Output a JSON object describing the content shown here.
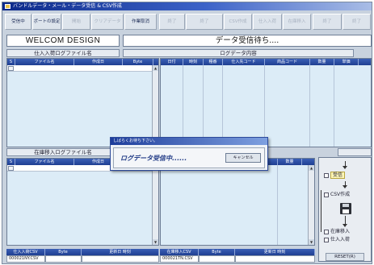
{
  "window": {
    "title": "バンドルデータ・メール・データ受信 & CSV作成"
  },
  "toolbar": {
    "buttons": [
      {
        "label": "受信中",
        "enabled": true
      },
      {
        "label": "ポートの設定",
        "enabled": true
      },
      {
        "label": "開始",
        "enabled": false
      },
      {
        "label": "クリアデータ",
        "enabled": false
      },
      {
        "label": "作業取消",
        "enabled": true
      },
      {
        "label": "終了",
        "enabled": false
      },
      {
        "label": "終了",
        "enabled": false
      },
      {
        "label": "CSV作成",
        "enabled": false
      },
      {
        "label": "仕入入荷",
        "enabled": false
      },
      {
        "label": "在庫移入",
        "enabled": false
      },
      {
        "label": "終了",
        "enabled": false
      },
      {
        "label": "終了",
        "enabled": false
      }
    ]
  },
  "banner": {
    "company": "WELCOM DESIGN",
    "status": "データ受信待ち...."
  },
  "left_top": {
    "header": "仕入入荷ログファイル名",
    "columns": [
      "S",
      "ファイル名",
      "作成日",
      "Byte"
    ]
  },
  "log_data": {
    "header": "ログデータ内容",
    "columns": [
      "日付",
      "時刻",
      "種番",
      "仕入先コード",
      "商品コード",
      "数量",
      "単価"
    ]
  },
  "left_bottom": {
    "header": "在庫移入ログファイル名",
    "columns": [
      "S",
      "ファイル名",
      "作成日"
    ]
  },
  "lower_right": {
    "columns": [
      "数量"
    ]
  },
  "footer": {
    "left_labels": [
      "仕入入荷CSV",
      "Byte",
      "更新日 時刻"
    ],
    "left_value": "000021NY.CSV",
    "right_labels": [
      "在庫移入CSV",
      "Byte",
      "更新日 時刻"
    ],
    "right_value": "000021TN.CSV"
  },
  "flow": {
    "receive": "受信",
    "csv": "CSV作成",
    "stock_in": "在庫移入",
    "purchase_in": "仕入入荷",
    "reset": "RESET(R)"
  },
  "dialog": {
    "title": "しばらくお待ち下さい。",
    "message": "ログデータ受信中......",
    "cancel": "キャンセル"
  },
  "colors": {
    "title_bar": "#0d2a8a",
    "column_header": "#1f3f92",
    "panel_bg": "#dcecf7",
    "window_bg": "#c8d2de"
  }
}
